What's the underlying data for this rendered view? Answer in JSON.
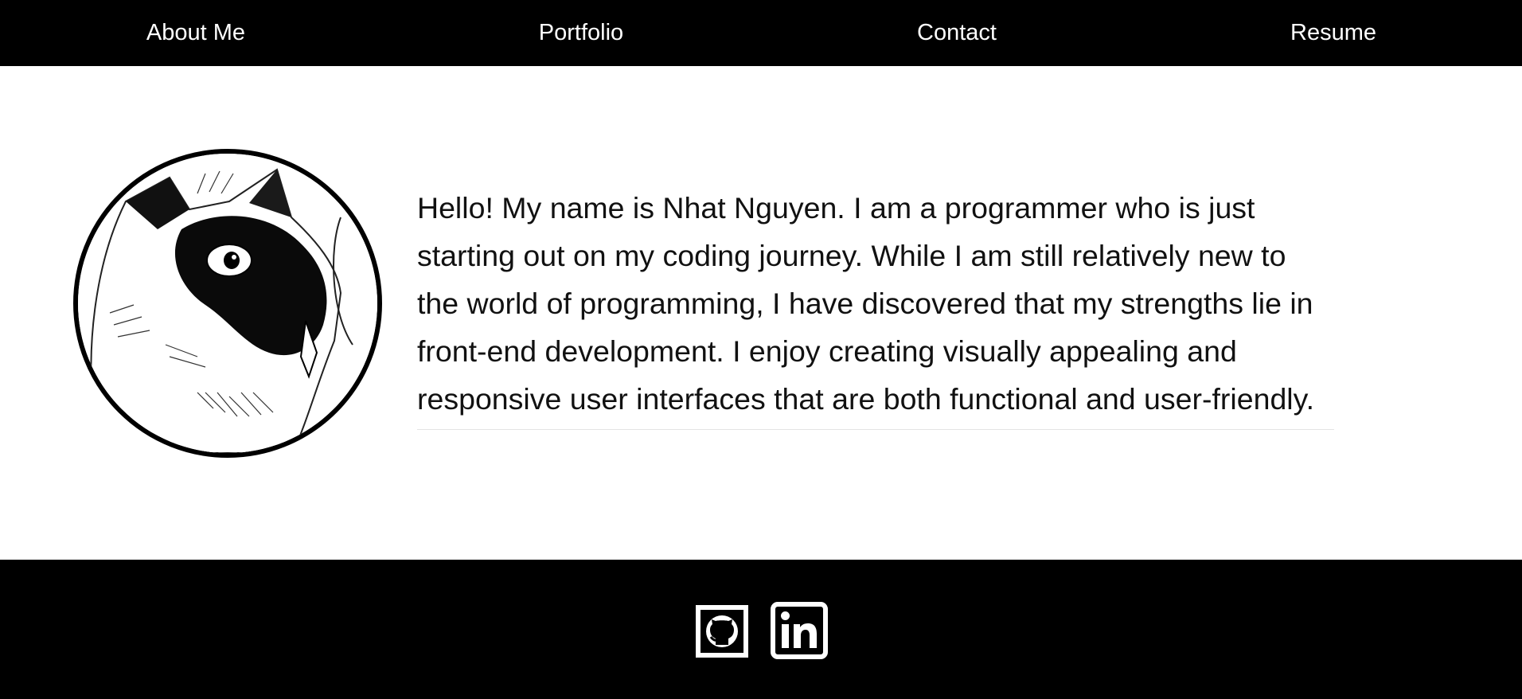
{
  "nav": {
    "items": [
      {
        "label": "About Me"
      },
      {
        "label": "Portfolio"
      },
      {
        "label": "Contact"
      },
      {
        "label": "Resume"
      }
    ]
  },
  "main": {
    "avatar_icon": "siamese-cat-illustration",
    "bio": "Hello! My name is Nhat Nguyen. I am a programmer who is just starting out on my coding journey. While I am still relatively new to the world of programming, I have discovered that my strengths lie in front-end development. I enjoy creating visually appealing and responsive user interfaces that are both functional and user-friendly."
  },
  "footer": {
    "social": [
      {
        "icon": "github-icon"
      },
      {
        "icon": "linkedin-icon"
      }
    ]
  },
  "colors": {
    "nav_background": "#000000",
    "footer_background": "#000000",
    "page_background": "#ffffff",
    "nav_text": "#ffffff",
    "body_text": "#111111"
  }
}
